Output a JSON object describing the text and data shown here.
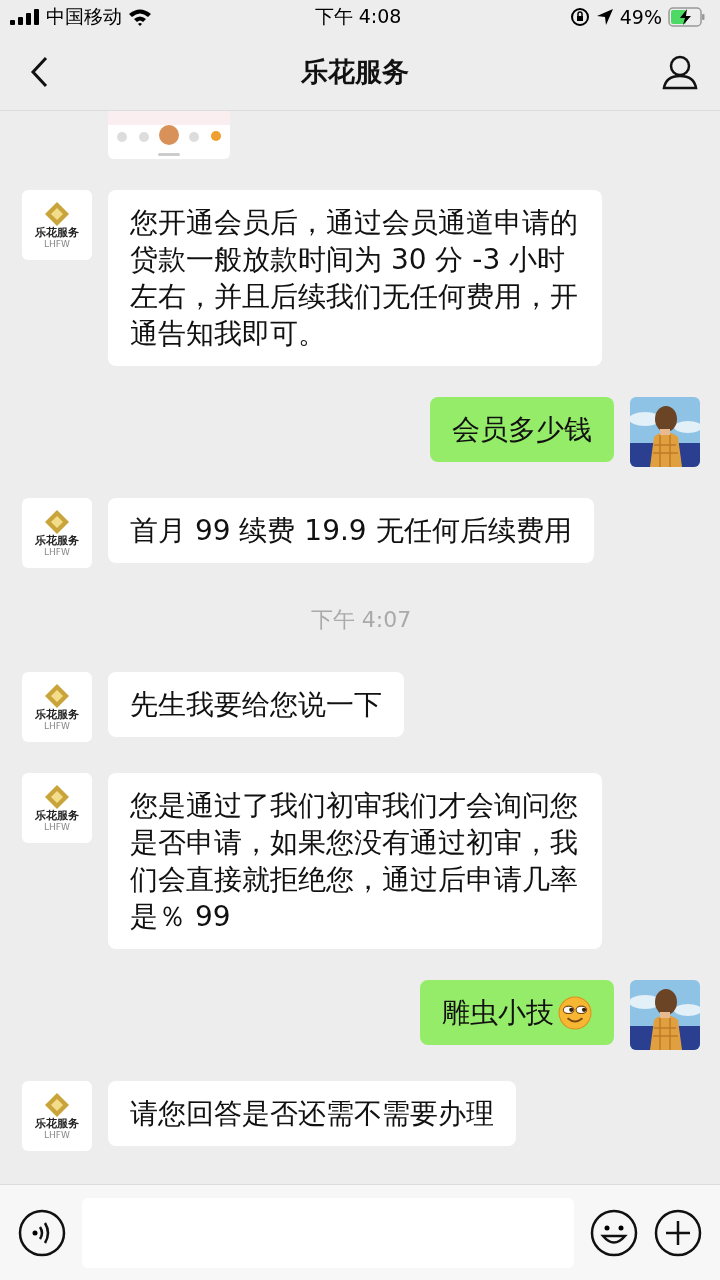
{
  "status_bar": {
    "carrier": "中国移动",
    "time": "下午 4:08",
    "battery": "49%"
  },
  "nav": {
    "title": "乐花服务"
  },
  "messages": [
    {
      "kind": "picture"
    },
    {
      "kind": "incoming",
      "avatar": {
        "name": "乐花服务",
        "sub": "LHFW"
      },
      "text": "您开通会员后，通过会员通道申请的贷款一般放款时间为 30 分 -3 小时左右，并且后续我们无任何费用，开通告知我即可。"
    },
    {
      "kind": "outgoing",
      "text": "会员多少钱"
    },
    {
      "kind": "incoming",
      "avatar": {
        "name": "乐花服务",
        "sub": "LHFW"
      },
      "text": "首月 99 续费 19.9 无任何后续费用"
    },
    {
      "kind": "time",
      "text": "下午 4:07"
    },
    {
      "kind": "incoming",
      "avatar": {
        "name": "乐花服务",
        "sub": "LHFW"
      },
      "text": "先生我要给您说一下"
    },
    {
      "kind": "incoming",
      "avatar": {
        "name": "乐花服务",
        "sub": "LHFW"
      },
      "text": "您是通过了我们初审我们才会询问您是否申请，如果您没有通过初审，我们会直接就拒绝您，通过后申请几率是％ 99"
    },
    {
      "kind": "outgoing",
      "text": "雕虫小技",
      "emoji": true
    },
    {
      "kind": "incoming",
      "avatar": {
        "name": "乐花服务",
        "sub": "LHFW"
      },
      "text": "请您回答是否还需不需要办理"
    }
  ]
}
